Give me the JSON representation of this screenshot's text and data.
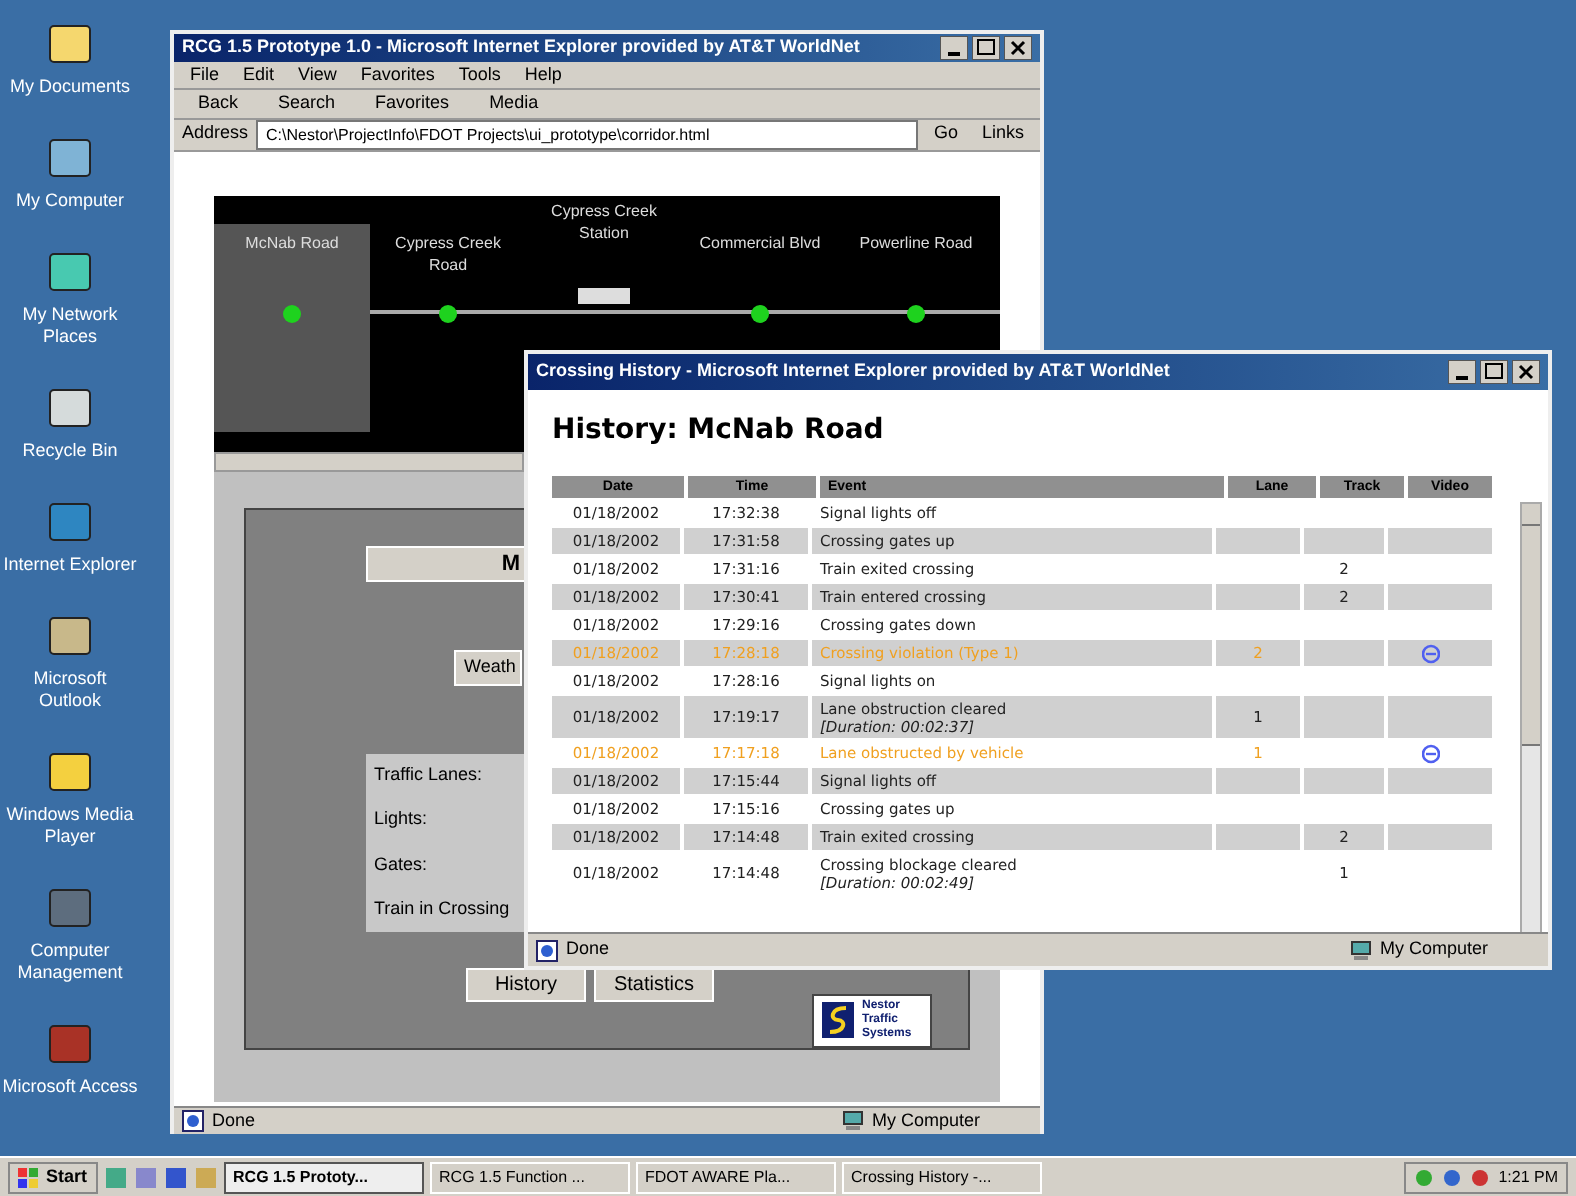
{
  "desktop_icons": [
    {
      "label": "My Documents"
    },
    {
      "label": "My Computer"
    },
    {
      "label": "My Network Places"
    },
    {
      "label": "Recycle Bin"
    },
    {
      "label": "Internet Explorer"
    },
    {
      "label": "Microsoft Outlook"
    },
    {
      "label": "Windows Media Player"
    },
    {
      "label": "Computer Management"
    },
    {
      "label": "Microsoft Access"
    }
  ],
  "main_window": {
    "title": "RCG 1.5 Prototype 1.0 - Microsoft Internet Explorer provided by AT&T WorldNet",
    "menu": [
      "File",
      "Edit",
      "View",
      "Favorites",
      "Tools",
      "Help"
    ],
    "toolbar": [
      "Back",
      "Search",
      "Favorites",
      "Media"
    ],
    "address_label": "Address",
    "address": "C:\\Nestor\\ProjectInfo\\FDOT Projects\\ui_prototype\\corridor.html",
    "go": "Go",
    "links": "Links",
    "crossings": [
      {
        "name": "McNab Road",
        "kind": "crossing",
        "selected": true
      },
      {
        "name": "Cypress Creek Road",
        "kind": "crossing",
        "selected": false
      },
      {
        "name": "Cypress Creek Station",
        "kind": "station",
        "selected": false
      },
      {
        "name": "Commercial Blvd",
        "kind": "crossing",
        "selected": false
      },
      {
        "name": "Powerline Road",
        "kind": "crossing",
        "selected": false
      }
    ],
    "panel_title": "M",
    "weather_button": "Weath",
    "status_labels": [
      "Traffic Lanes:",
      "Lights:",
      "Gates:",
      "Train in Crossing"
    ],
    "buttons": [
      "History",
      "Statistics"
    ],
    "logo_text": "Nestor Traffic Systems",
    "status": "Done",
    "zone": "My Computer"
  },
  "history_window": {
    "title": "Crossing History - Microsoft Internet Explorer provided by AT&T WorldNet",
    "heading": "History: McNab Road",
    "columns": [
      "Date",
      "Time",
      "Event",
      "Lane",
      "Track",
      "Video"
    ],
    "rows": [
      {
        "kind": "normal",
        "date": "01/18/2002",
        "time": "17:32:38",
        "event": "Signal lights off",
        "lane": "",
        "track": "",
        "video": false
      },
      {
        "kind": "normal",
        "date": "01/18/2002",
        "time": "17:31:58",
        "event": "Crossing gates up",
        "lane": "",
        "track": "",
        "video": false
      },
      {
        "kind": "normal",
        "date": "01/18/2002",
        "time": "17:31:16",
        "event": "Train exited crossing",
        "lane": "",
        "track": "2",
        "video": false
      },
      {
        "kind": "normal",
        "date": "01/18/2002",
        "time": "17:30:41",
        "event": "Train entered crossing",
        "lane": "",
        "track": "2",
        "video": false
      },
      {
        "kind": "normal",
        "date": "01/18/2002",
        "time": "17:29:16",
        "event": "Crossing gates down",
        "lane": "",
        "track": "",
        "video": false
      },
      {
        "kind": "alert",
        "date": "01/18/2002",
        "time": "17:28:18",
        "event": "Crossing violation (Type 1)",
        "lane": "2",
        "track": "",
        "video": true
      },
      {
        "kind": "normal",
        "date": "01/18/2002",
        "time": "17:28:16",
        "event": "Signal lights on",
        "lane": "",
        "track": "",
        "video": false
      },
      {
        "kind": "normal",
        "date": "01/18/2002",
        "time": "17:19:17",
        "event": "Lane obstruction cleared",
        "note": "[Duration: 00:02:37]",
        "lane": "1",
        "track": "",
        "video": false
      },
      {
        "kind": "alert",
        "date": "01/18/2002",
        "time": "17:17:18",
        "event": "Lane obstructed by vehicle",
        "lane": "1",
        "track": "",
        "video": true
      },
      {
        "kind": "normal",
        "date": "01/18/2002",
        "time": "17:15:44",
        "event": "Signal lights off",
        "lane": "",
        "track": "",
        "video": false
      },
      {
        "kind": "normal",
        "date": "01/18/2002",
        "time": "17:15:16",
        "event": "Crossing gates up",
        "lane": "",
        "track": "",
        "video": false
      },
      {
        "kind": "normal",
        "date": "01/18/2002",
        "time": "17:14:48",
        "event": "Train exited crossing",
        "lane": "",
        "track": "2",
        "video": false
      },
      {
        "kind": "normal",
        "date": "01/18/2002",
        "time": "17:14:48",
        "event": "Crossing blockage cleared",
        "note": "[Duration: 00:02:49]",
        "lane": "",
        "track": "1",
        "video": false
      }
    ],
    "status": "Done",
    "zone": "My Computer"
  },
  "taskbar": {
    "start": "Start",
    "tasks": [
      {
        "label": "RCG 1.5 Prototy...",
        "selected": true
      },
      {
        "label": "RCG 1.5 Function ...",
        "selected": false
      },
      {
        "label": "FDOT AWARE Pla...",
        "selected": false
      },
      {
        "label": "Crossing History -...",
        "selected": false
      }
    ],
    "clock": "1:21 PM"
  }
}
